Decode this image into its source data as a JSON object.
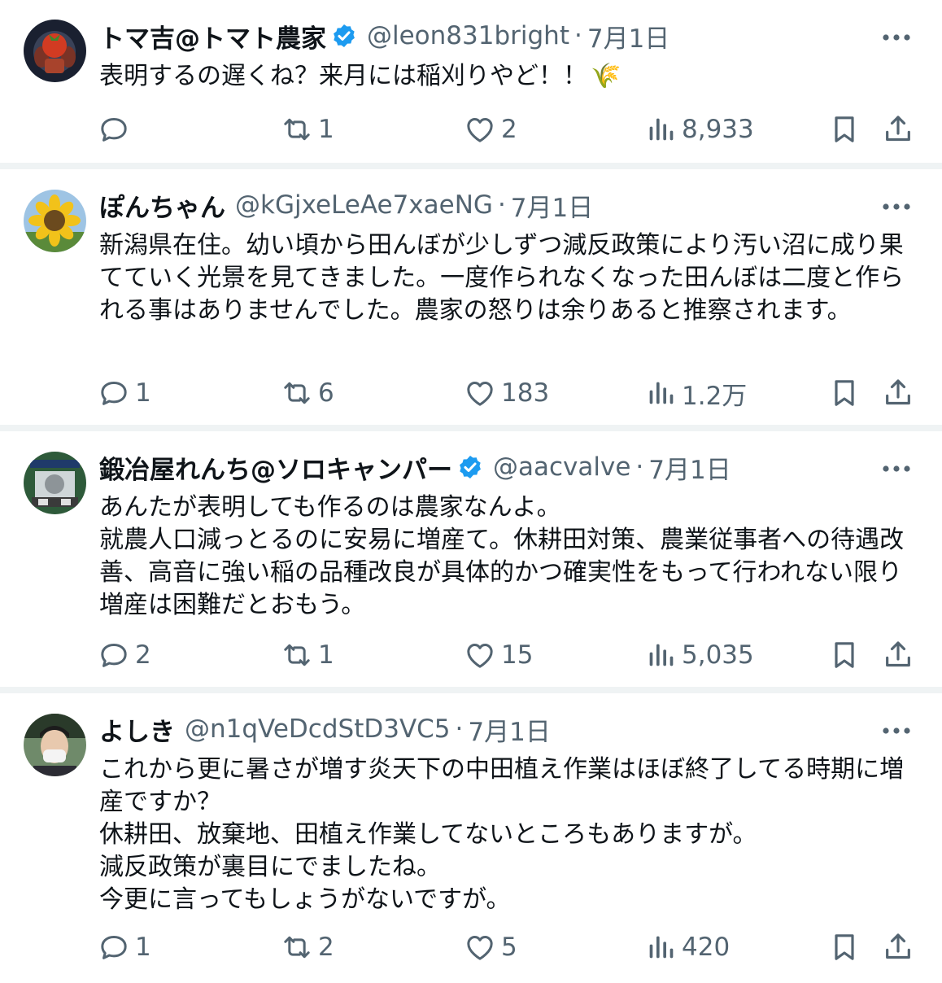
{
  "replies": [
    {
      "name": "トマ吉@トマト農家",
      "verified": true,
      "handle": "@leon831bright",
      "separator": "·",
      "date": "7月1日",
      "text": "表明するの遅くね？来月には稲刈りやど！！",
      "emoji": "🌾",
      "reply_count": "",
      "retweet_count": "1",
      "like_count": "2",
      "view_count": "8,933",
      "avatar_icon": "tomato-muscle-avatar"
    },
    {
      "name": "ぽんちゃん",
      "verified": false,
      "handle": "@kGjxeLeAe7xaeNG",
      "separator": "·",
      "date": "7月1日",
      "text": "新潟県在住。幼い頃から田んぼが少しずつ減反政策により汚い沼に成り果てていく光景を見てきました。一度作られなくなった田んぼは二度と作られる事はありませんでした。農家の怒りは余りあると推察されます。",
      "emoji": "",
      "reply_count": "1",
      "retweet_count": "6",
      "like_count": "183",
      "view_count": "1.2万",
      "avatar_icon": "sunflower-avatar"
    },
    {
      "name": "鍛冶屋れんち@ソロキャンパー",
      "verified": true,
      "handle": "@aacvalve",
      "separator": "·",
      "date": "7月1日",
      "text": "あんたが表明しても作るのは農家なんよ。\n就農人口減っとるのに安易に増産て。休耕田対策、農業従事者への待遇改善、高音に強い稲の品種改良が具体的かつ確実性をもって行われない限り増産は困難だとおもう。",
      "emoji": "",
      "reply_count": "2",
      "retweet_count": "1",
      "like_count": "15",
      "view_count": "5,035",
      "avatar_icon": "camp-badge-avatar"
    },
    {
      "name": "よしき",
      "verified": false,
      "handle": "@n1qVeDcdStD3VC5",
      "separator": "·",
      "date": "7月1日",
      "text": "これから更に暑さが増す炎天下の中田植え作業はほぼ終了してる時期に増産ですか？\n休耕田、放棄地、田植え作業してないところもありますが。\n減反政策が裏目にでましたね。\n今更に言ってもしょうがないですが。",
      "emoji": "",
      "reply_count": "1",
      "retweet_count": "2",
      "like_count": "5",
      "view_count": "420",
      "avatar_icon": "masked-person-avatar"
    }
  ],
  "colors": {
    "text": "#0f1419",
    "secondary": "#536471",
    "verified": "#1d9bf0",
    "separator": "#eff3f4"
  },
  "icons": [
    "reply-icon",
    "retweet-icon",
    "like-icon",
    "views-icon",
    "bookmark-icon",
    "share-icon",
    "more-icon",
    "verified-badge-icon"
  ]
}
